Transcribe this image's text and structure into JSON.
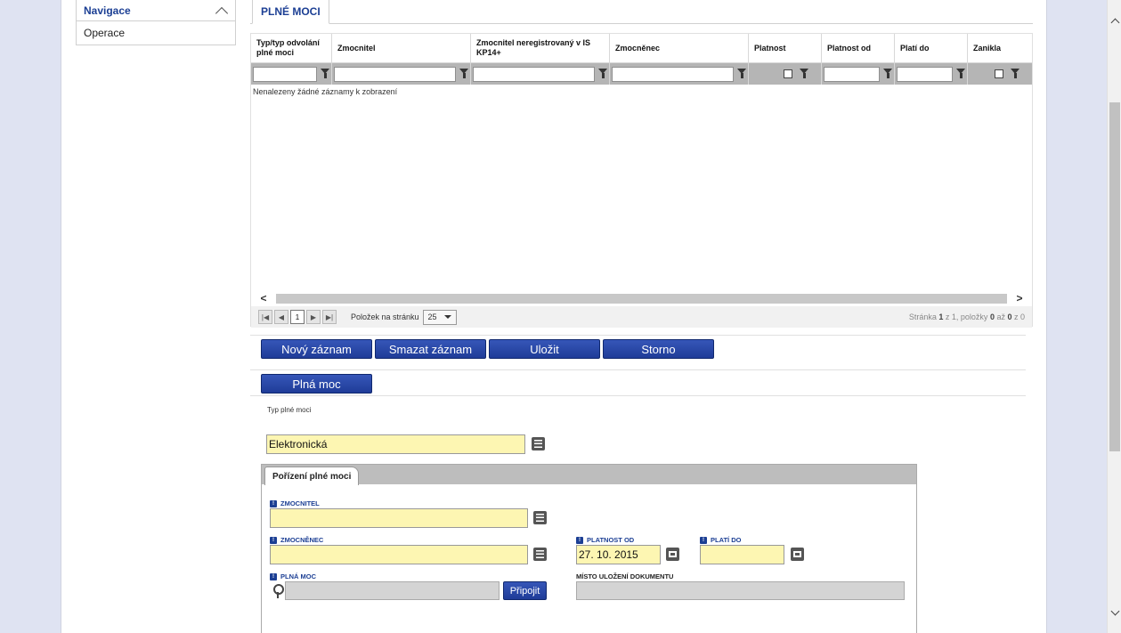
{
  "nav": {
    "header_label": "Navigace",
    "items": [
      {
        "label": "Operace"
      }
    ]
  },
  "tab": {
    "label": "PLNÉ MOCI"
  },
  "grid": {
    "columns": [
      "Typ/typ odvolání plné moci",
      "Zmocnitel",
      "Zmocnitel neregistrovaný v IS KP14+",
      "Zmocněnec",
      "Platnost",
      "Platnost od",
      "Platí do",
      "Zanikla"
    ],
    "empty_message": "Nenalezeny žádné záznamy k zobrazení"
  },
  "pager": {
    "current_page": "1",
    "per_page_label": "Položek na stránku",
    "per_page_value": "25",
    "info_prefix": "Stránka ",
    "info_page": "1",
    "info_of": " z 1, položky ",
    "info_from": "0",
    "info_to_label": " až ",
    "info_to": "0",
    "info_total_label": " z 0"
  },
  "actions": {
    "new": "Nový záznam",
    "delete": "Smazat záznam",
    "save": "Uložit",
    "cancel": "Storno"
  },
  "section": {
    "plna_moc_button": "Plná moc"
  },
  "typ_plne_moci": {
    "label": "Typ plné moci",
    "value": "Elektronická"
  },
  "subtab": {
    "label": "Pořízení plné moci"
  },
  "form": {
    "zmocnitel_label": "ZMOCNITEL",
    "zmocnenec_label": "ZMOCNĚNEC",
    "platnost_od_label": "PLATNOST OD",
    "platnost_od_value": "27. 10. 2015",
    "plati_do_label": "PLATÍ DO",
    "plna_moc_label": "PLNÁ MOC",
    "pripojit_label": "Připojit",
    "misto_label": "MÍSTO ULOŽENÍ DOKUMENTU",
    "required_mark": "!"
  }
}
